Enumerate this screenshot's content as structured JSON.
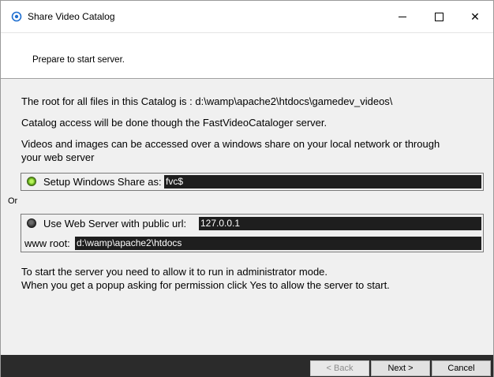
{
  "window": {
    "title": "Share Video Catalog",
    "minimize_label": "",
    "maximize_label": "",
    "close_label": "✕"
  },
  "header": {
    "text": "Prepare to start server."
  },
  "body": {
    "root_line": "The root for all files in this Catalog is : d:\\wamp\\apache2\\htdocs\\gamedev_videos\\",
    "access_line": "Catalog access will be done though the FastVideoCataloger server.",
    "videos_line1": "Videos and images can be accessed over a windows share on your local network or through",
    "videos_line2": "your web server",
    "or_label": "Or",
    "info_line1": "To start the server you need to allow it to run in administrator mode.",
    "info_line2": "When you get a popup asking for permission click Yes to allow the server to start."
  },
  "share_option": {
    "label": "Setup Windows Share as:",
    "value": "fvc$",
    "selected": true
  },
  "web_option": {
    "label": "Use Web Server with public url:",
    "url_value": "127.0.0.1",
    "selected": false,
    "www_root_label": "www root:",
    "www_root_value": "d:\\wamp\\apache2\\htdocs"
  },
  "footer": {
    "back_label": "< Back",
    "next_label": "Next >",
    "cancel_label": "Cancel"
  },
  "colors": {
    "footer_bg": "#2b2b2b",
    "input_bg": "#1e1e1e",
    "radio_on": "#69b01f"
  }
}
